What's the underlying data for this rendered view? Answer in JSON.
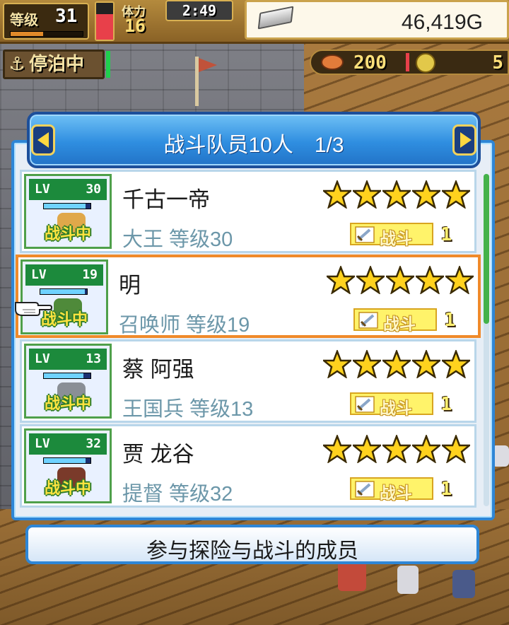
{
  "hud": {
    "level_label": "等级",
    "level_value": "31",
    "level_progress": 0.45,
    "stamina_label": "体力",
    "stamina_value": "16",
    "stamina_gauge_fraction": 0.7,
    "clock": "2:49",
    "money": "46,419G",
    "anchor_status": "停泊中",
    "food_value": "200",
    "coin_value": "5"
  },
  "dialog": {
    "title": "战斗队员10人",
    "page": "1/3",
    "caption": "参与探险与战斗的成员"
  },
  "members": [
    {
      "lv_label": "LV",
      "level": "30",
      "name": "千古一帝",
      "class_level": "大王 等级30",
      "stars": 5,
      "role": "战斗",
      "count": "1",
      "status": "战斗中",
      "hp_fraction": 0.9,
      "sprite_color": "#e0a84a",
      "selected": false
    },
    {
      "lv_label": "LV",
      "level": "19",
      "name": "明",
      "class_level": "召唤师 等级19",
      "stars": 5,
      "role": "战斗",
      "count": "1",
      "status": "战斗中",
      "hp_fraction": 0.95,
      "sprite_color": "#4f8a3a",
      "selected": true
    },
    {
      "lv_label": "LV",
      "level": "13",
      "name": "蔡 阿强",
      "class_level": "王国兵 等级13",
      "stars": 5,
      "role": "战斗",
      "count": "1",
      "status": "战斗中",
      "hp_fraction": 0.85,
      "sprite_color": "#8a8f96",
      "selected": false
    },
    {
      "lv_label": "LV",
      "level": "32",
      "name": "贾 龙谷",
      "class_level": "提督 等级32",
      "stars": 5,
      "role": "战斗",
      "count": "1",
      "status": "战斗中",
      "hp_fraction": 0.9,
      "sprite_color": "#7a3a2a",
      "selected": false
    }
  ],
  "icons": {
    "money": "silver-bar-icon",
    "anchor": "anchor-icon",
    "food": "meat-icon",
    "coin": "medal-icon",
    "prev": "arrow-left-icon",
    "next": "arrow-right-icon",
    "pointer": "pointing-hand-icon",
    "role": "sword-icon",
    "star": "star-icon"
  },
  "colors": {
    "accent_blue": "#2e86d6",
    "selected_border": "#f08a2a",
    "class_text": "#6c97a9",
    "star_yellow": "#ffd21e",
    "scroll_thumb": "#44b24a"
  },
  "scroll": {
    "position_fraction": 0.0,
    "visible_fraction": 0.45
  }
}
